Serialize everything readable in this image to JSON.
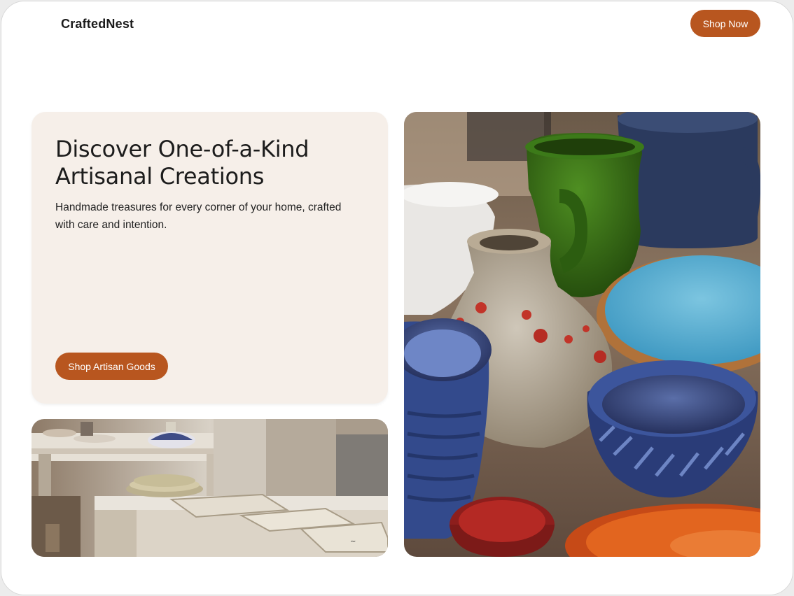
{
  "header": {
    "logo": "CraftedNest",
    "shop_now_label": "Shop Now"
  },
  "hero": {
    "title": "Discover One-of-a-Kind Artisanal Creations",
    "subtitle": "Handmade treasures for every corner of your home, crafted with care and intention.",
    "cta_label": "Shop Artisan Goods"
  },
  "colors": {
    "accent": "#b8561f",
    "hero_card_bg": "#f6efe9",
    "page_bg": "#ffffff"
  }
}
